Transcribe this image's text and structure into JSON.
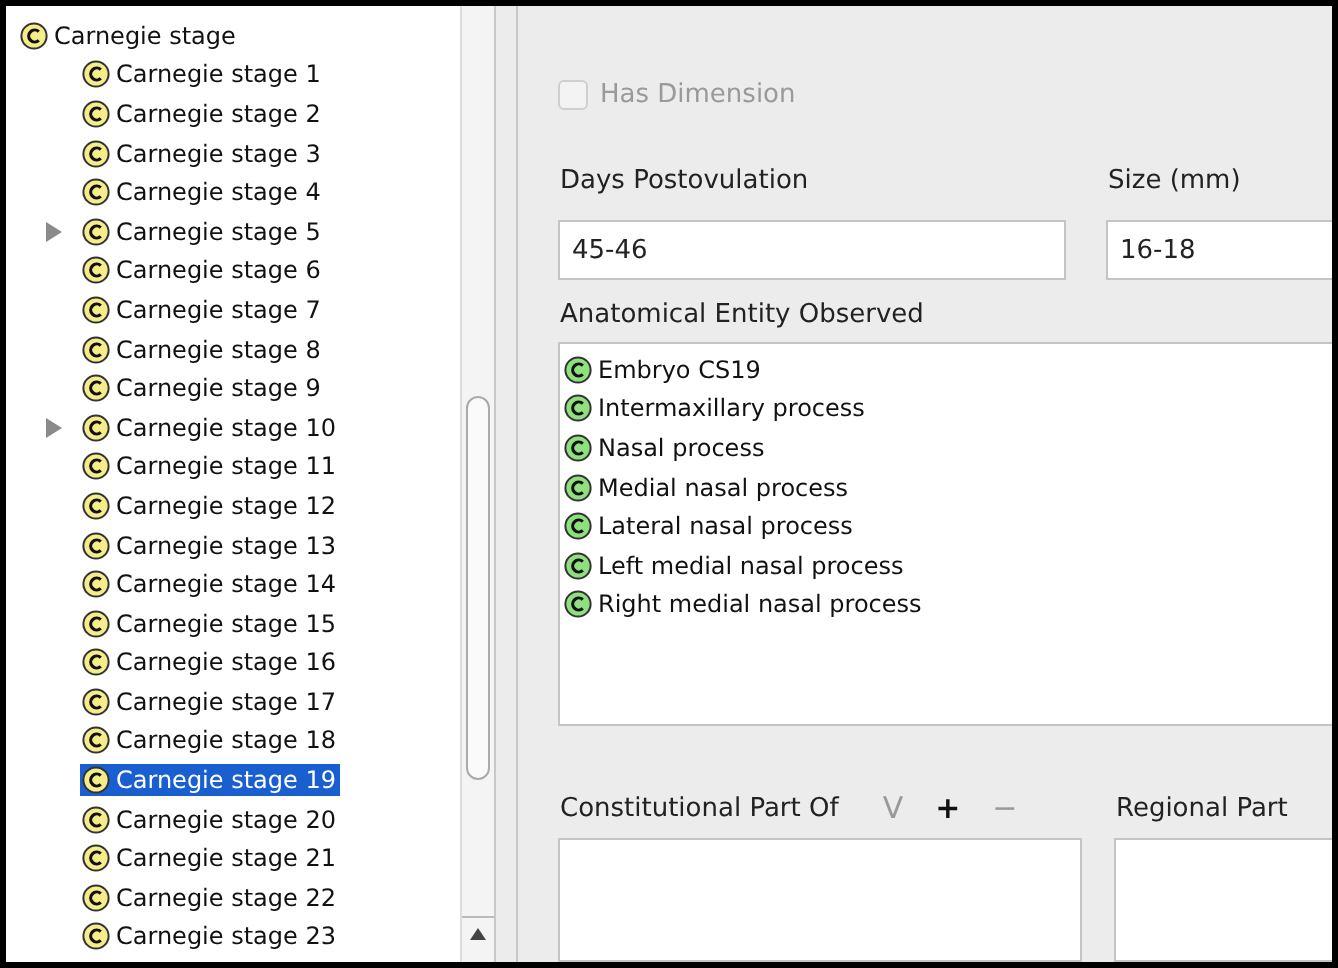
{
  "tree": {
    "label": "Carnegie stage",
    "selected": false,
    "children": [
      {
        "label": "Carnegie stage 1",
        "selected": false,
        "has_children": false
      },
      {
        "label": "Carnegie stage 2",
        "selected": false,
        "has_children": false
      },
      {
        "label": "Carnegie stage 3",
        "selected": false,
        "has_children": false
      },
      {
        "label": "Carnegie stage 4",
        "selected": false,
        "has_children": false
      },
      {
        "label": "Carnegie stage 5",
        "selected": false,
        "has_children": true
      },
      {
        "label": "Carnegie stage 6",
        "selected": false,
        "has_children": false
      },
      {
        "label": "Carnegie stage 7",
        "selected": false,
        "has_children": false
      },
      {
        "label": "Carnegie stage 8",
        "selected": false,
        "has_children": false
      },
      {
        "label": "Carnegie stage 9",
        "selected": false,
        "has_children": false
      },
      {
        "label": "Carnegie stage 10",
        "selected": false,
        "has_children": true
      },
      {
        "label": "Carnegie stage 11",
        "selected": false,
        "has_children": false
      },
      {
        "label": "Carnegie stage 12",
        "selected": false,
        "has_children": false
      },
      {
        "label": "Carnegie stage 13",
        "selected": false,
        "has_children": false
      },
      {
        "label": "Carnegie stage 14",
        "selected": false,
        "has_children": false
      },
      {
        "label": "Carnegie stage 15",
        "selected": false,
        "has_children": false
      },
      {
        "label": "Carnegie stage 16",
        "selected": false,
        "has_children": false
      },
      {
        "label": "Carnegie stage 17",
        "selected": false,
        "has_children": false
      },
      {
        "label": "Carnegie stage 18",
        "selected": false,
        "has_children": false
      },
      {
        "label": "Carnegie stage 19",
        "selected": true,
        "has_children": false
      },
      {
        "label": "Carnegie stage 20",
        "selected": false,
        "has_children": false
      },
      {
        "label": "Carnegie stage 21",
        "selected": false,
        "has_children": false
      },
      {
        "label": "Carnegie stage 22",
        "selected": false,
        "has_children": false
      },
      {
        "label": "Carnegie stage 23",
        "selected": false,
        "has_children": false
      }
    ]
  },
  "has_dimension": {
    "label": "Has Dimension",
    "checked": false,
    "disabled": true
  },
  "fields": [
    {
      "label": "Days Postovulation",
      "value": "45-46"
    },
    {
      "label": "Size (mm)",
      "value": "16-18"
    }
  ],
  "anatomical_entity": {
    "label": "Anatomical Entity Observed",
    "items": [
      "Embryo CS19",
      "Intermaxillary process",
      "Nasal process",
      "Medial nasal process",
      "Lateral nasal process",
      "Left medial nasal process",
      "Right medial nasal process"
    ]
  },
  "relations": [
    {
      "label": "Constitutional Part Of",
      "buttons": [
        {
          "text": "V",
          "disabled": true
        },
        {
          "text": "+",
          "disabled": false
        },
        {
          "text": "−",
          "disabled": true
        }
      ]
    },
    {
      "label": "Regional Part"
    }
  ]
}
